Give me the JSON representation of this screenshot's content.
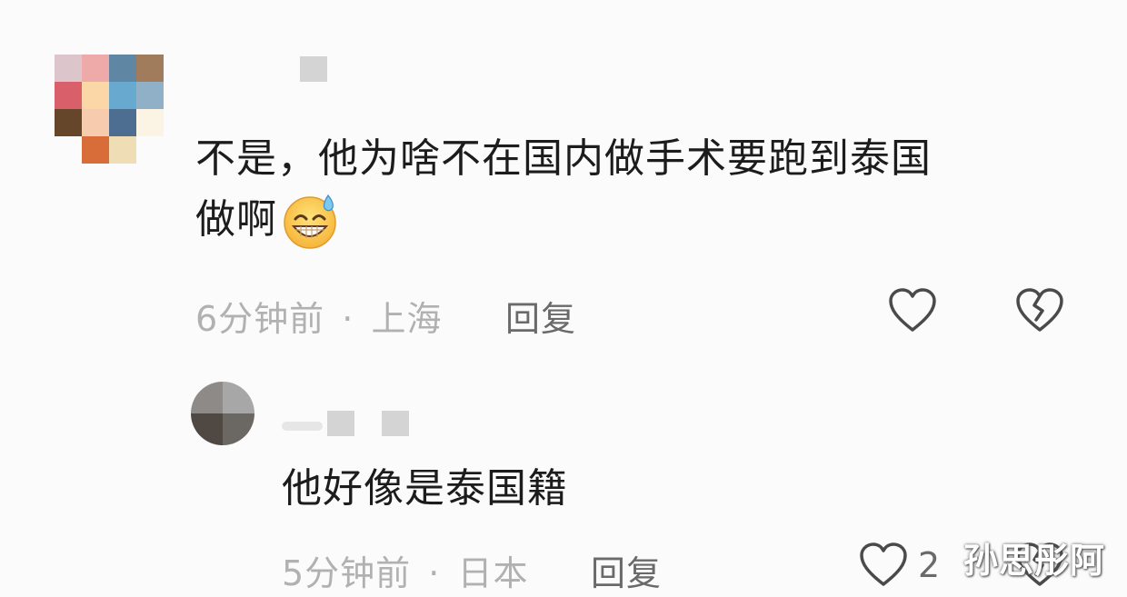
{
  "comment": {
    "text_line1": "不是，他为啥不在国内做手术要跑到泰国",
    "text_line2": "做啊",
    "emoji": "😅",
    "time": "6分钟前",
    "sep": "·",
    "location": "上海",
    "reply_label": "回复",
    "avatar_colors": [
      "#dcc6cc",
      "#eeaaa9",
      "#5f86a3",
      "#a07c5c",
      "#d9606a",
      "#fbd6a6",
      "#68a9d0",
      "#8fb0c6",
      "#66462a",
      "#f6cbae",
      "#4d6e90",
      "#fbf3e4",
      "#fbfbfb",
      "#d96d3a",
      "#efdeb5",
      "#fbfbfb"
    ]
  },
  "reply": {
    "text": "他好像是泰国籍",
    "time": "5分钟前",
    "sep": "·",
    "location": "日本",
    "reply_label": "回复",
    "like_count": "2",
    "avatar_colors": [
      "#8e8a87",
      "#a7a7a7",
      "#4f4843",
      "#6b6763"
    ]
  },
  "watermark": "孙思彤阿",
  "colors": {
    "heart": "#4a4a4a",
    "meta": "#b1b1b1",
    "text": "#1c1c1c"
  },
  "icons": [
    "heart-outline-icon",
    "broken-heart-icon"
  ]
}
